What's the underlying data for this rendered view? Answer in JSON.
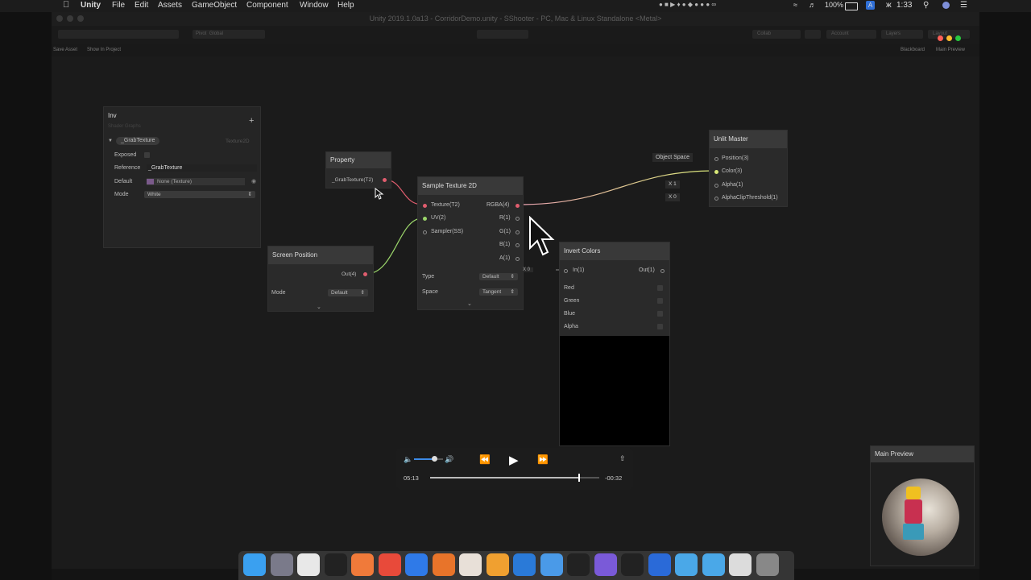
{
  "menubar": {
    "app": "Unity",
    "menus": [
      "File",
      "Edit",
      "Assets",
      "GameObject",
      "Component",
      "Window",
      "Help"
    ],
    "battery": "100%",
    "user_initial": "A",
    "user_name": "ж",
    "clock": "1:33"
  },
  "window": {
    "title": "Unity 2019.1.0a13 - CorridorDemo.unity - SShooter - PC, Mac & Linux Standalone <Metal>",
    "toolbar": {
      "pivot": "Pivot",
      "global": "Global",
      "collab": "Collab",
      "account": "Account",
      "layers": "Layers",
      "layout": "Layout"
    }
  },
  "graph_toolbar": {
    "save_asset": "Save Asset",
    "show_in_project": "Show In Project",
    "blackboard": "Blackboard",
    "main_preview": "Main Preview"
  },
  "blackboard": {
    "title": "Inv",
    "subtitle": "Shader Graphs",
    "property_name": "_GrabTexture",
    "property_type": "Texture2D",
    "exposed_label": "Exposed",
    "reference_label": "Reference",
    "reference_value": "_GrabTexture",
    "default_label": "Default",
    "default_value": "None (Texture)",
    "mode_label": "Mode",
    "mode_value": "White"
  },
  "property_node": {
    "title": "Property",
    "port": "_GrabTexture(T2)"
  },
  "screen_position_node": {
    "title": "Screen Position",
    "out": "Out(4)",
    "mode_label": "Mode",
    "mode_value": "Default"
  },
  "sample_node": {
    "title": "Sample Texture 2D",
    "inputs": [
      "Texture(T2)",
      "UV(2)",
      "Sampler(SS)"
    ],
    "outputs": [
      "RGBA(4)",
      "R(1)",
      "G(1)",
      "B(1)",
      "A(1)"
    ],
    "type_label": "Type",
    "type_value": "Default",
    "space_label": "Space",
    "space_value": "Tangent"
  },
  "invert_node": {
    "title": "Invert Colors",
    "in": "In(1)",
    "out": "Out(1)",
    "in_default": "X 0",
    "channels": [
      "Red",
      "Green",
      "Blue",
      "Alpha"
    ]
  },
  "master_node": {
    "title": "Unlit Master",
    "inputs": [
      "Position(3)",
      "Color(3)",
      "Alpha(1)",
      "AlphaClipThreshold(1)"
    ],
    "object_space": "Object Space",
    "alpha_default": "X  1",
    "clip_default": "X  0"
  },
  "preview": {
    "title": "Main Preview"
  },
  "video": {
    "elapsed": "05:13",
    "remaining": "-00:32",
    "progress": 0.88,
    "volume": 0.7
  },
  "colors": {
    "accent_green": "#9bd66b",
    "texture_pink": "#e05d6e",
    "bg": "#1b1b1b"
  },
  "dock_icons": [
    "finder-icon",
    "launchpad-icon",
    "unity-hub-icon",
    "unity-icon",
    "sublime-icon",
    "chrome-icon",
    "maps-icon",
    "firefox-icon",
    "slack-icon",
    "app-icon",
    "vscode-icon",
    "keynote-icon",
    "unity-icon-2",
    "visual-studio-icon",
    "unity-icon-3",
    "1password-icon",
    "folder-icon",
    "folder-icon-2",
    "document-icon",
    "trash-icon"
  ]
}
